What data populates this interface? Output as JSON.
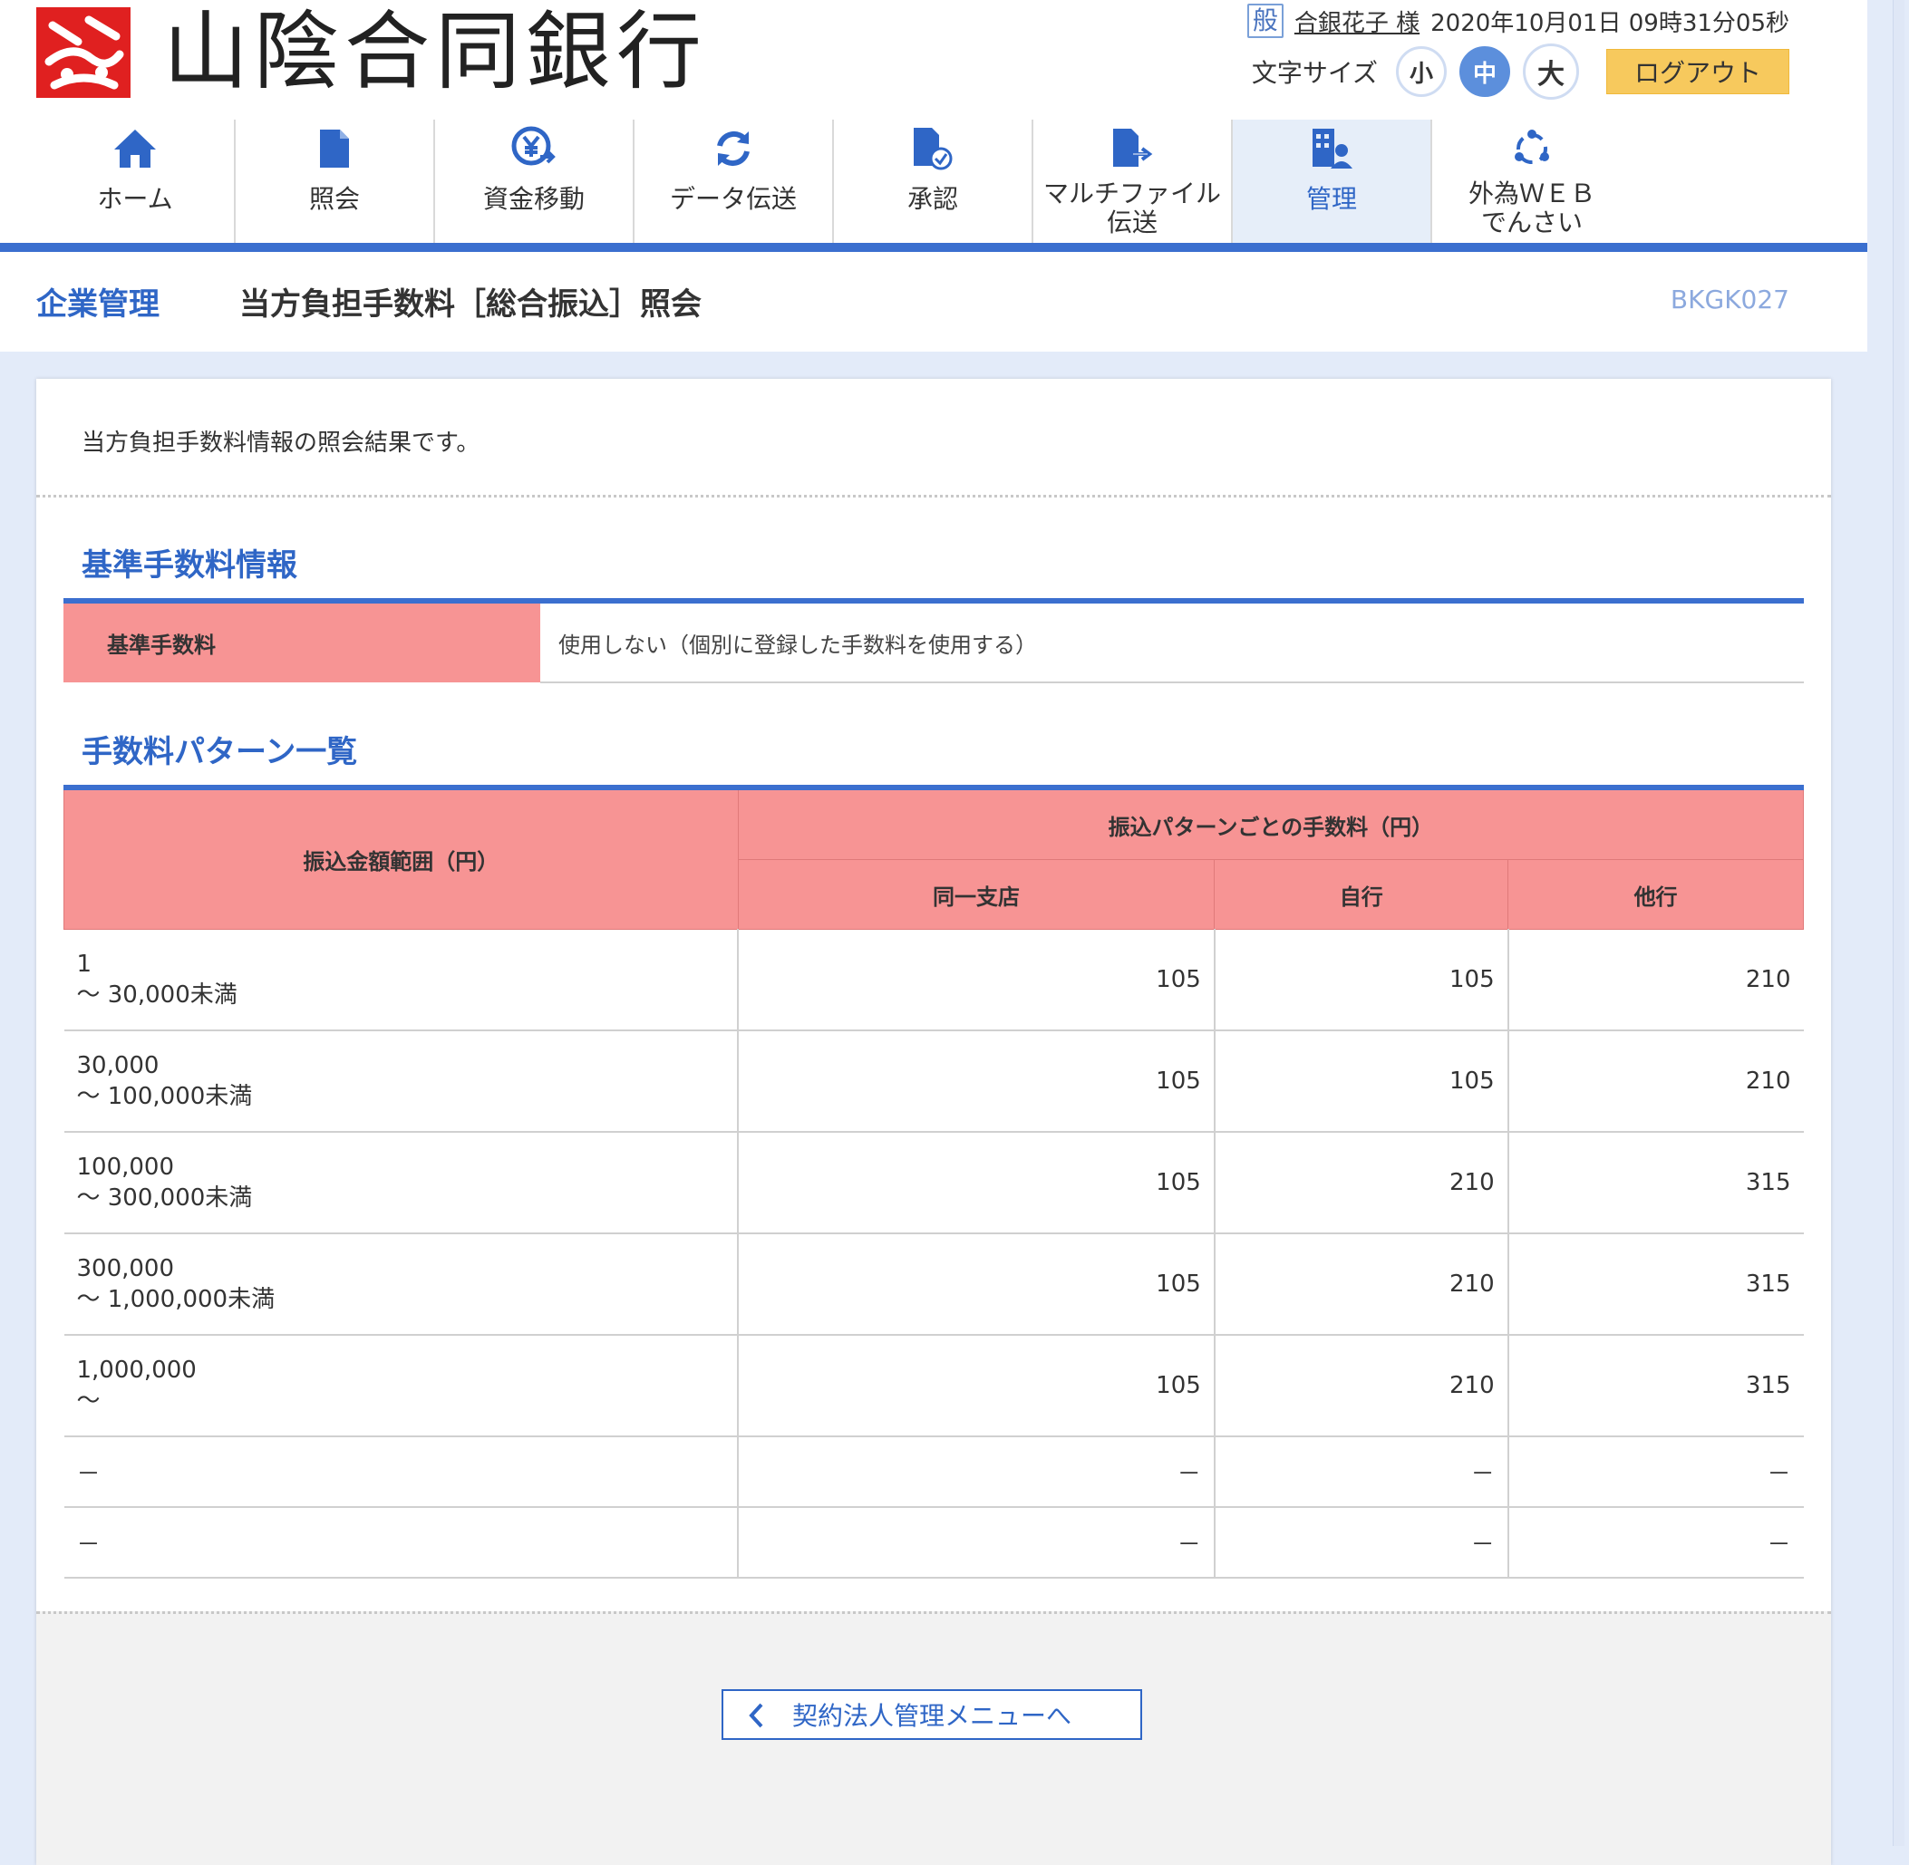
{
  "header": {
    "bank_name": "山陰合同銀行",
    "user_badge": "般",
    "user_name": "合銀花子 様",
    "datetime": "2020年10月01日 09時31分05秒",
    "font_size_label": "文字サイズ",
    "font_sizes": [
      "小",
      "中",
      "大"
    ],
    "font_size_selected": "中",
    "logout": "ログアウト"
  },
  "nav": [
    {
      "label": "ホーム",
      "icon": "home-icon"
    },
    {
      "label": "照会",
      "icon": "document-icon"
    },
    {
      "label": "資金移動",
      "icon": "yen-transfer-icon"
    },
    {
      "label": "データ伝送",
      "icon": "sync-icon"
    },
    {
      "label": "承認",
      "icon": "approve-document-icon"
    },
    {
      "label": "マルチファイル\n伝送",
      "icon": "file-send-icon"
    },
    {
      "label": "管理",
      "icon": "building-user-icon",
      "active": true
    },
    {
      "label": "外為ＷＥＢ\nでんさい",
      "icon": "network-icon"
    }
  ],
  "page": {
    "breadcrumb": "企業管理",
    "title": "当方負担手数料［総合振込］照会",
    "code": "BKGK027",
    "intro": "当方負担手数料情報の照会結果です。"
  },
  "standard_fee": {
    "heading": "基準手数料情報",
    "label": "基準手数料",
    "value": "使用しない（個別に登録した手数料を使用する）"
  },
  "pattern_list": {
    "heading": "手数料パターン一覧",
    "col_range": "振込金額範囲（円）",
    "col_group": "振込パターンごとの手数料（円）",
    "col_same_branch": "同一支店",
    "col_own_bank": "自行",
    "col_other_bank": "他行",
    "rows": [
      {
        "from": "1",
        "to": "～ 30,000未満",
        "same": "105",
        "own": "105",
        "other": "210"
      },
      {
        "from": "30,000",
        "to": "～ 100,000未満",
        "same": "105",
        "own": "105",
        "other": "210"
      },
      {
        "from": "100,000",
        "to": "～ 300,000未満",
        "same": "105",
        "own": "210",
        "other": "315"
      },
      {
        "from": "300,000",
        "to": "～ 1,000,000未満",
        "same": "105",
        "own": "210",
        "other": "315"
      },
      {
        "from": "1,000,000",
        "to": "～",
        "same": "105",
        "own": "210",
        "other": "315"
      }
    ],
    "empty_rows": [
      {
        "range": "－",
        "same": "－",
        "own": "－",
        "other": "－"
      },
      {
        "range": "－",
        "same": "－",
        "own": "－",
        "other": "－"
      }
    ]
  },
  "footer": {
    "back_button": "契約法人管理メニューへ"
  },
  "colors": {
    "accent": "#3b6fcf",
    "header_cell": "#f79494",
    "logout": "#f7c95d",
    "background": "#e3ebf9"
  }
}
